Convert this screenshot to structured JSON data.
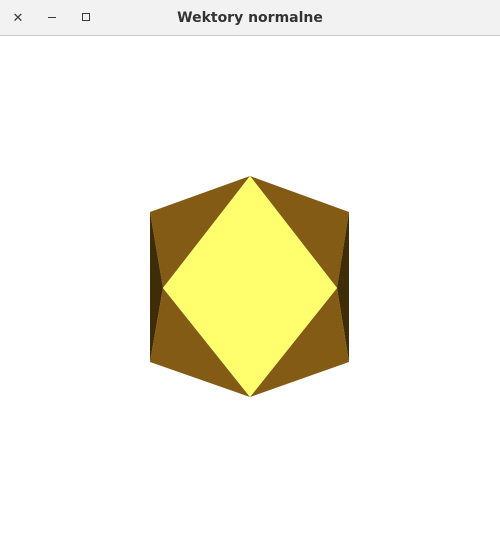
{
  "window": {
    "title": "Wektory normalne",
    "buttons": {
      "close_icon": "close-icon",
      "minimize_icon": "minimize-icon",
      "maximize_icon": "maximize-icon"
    }
  },
  "colors": {
    "titlebar_bg": "#f2f2f2",
    "canvas_bg": "#ffffff",
    "face_front": "#ffff6e",
    "face_side": "#845b14",
    "face_dark": "#3f2d07"
  }
}
